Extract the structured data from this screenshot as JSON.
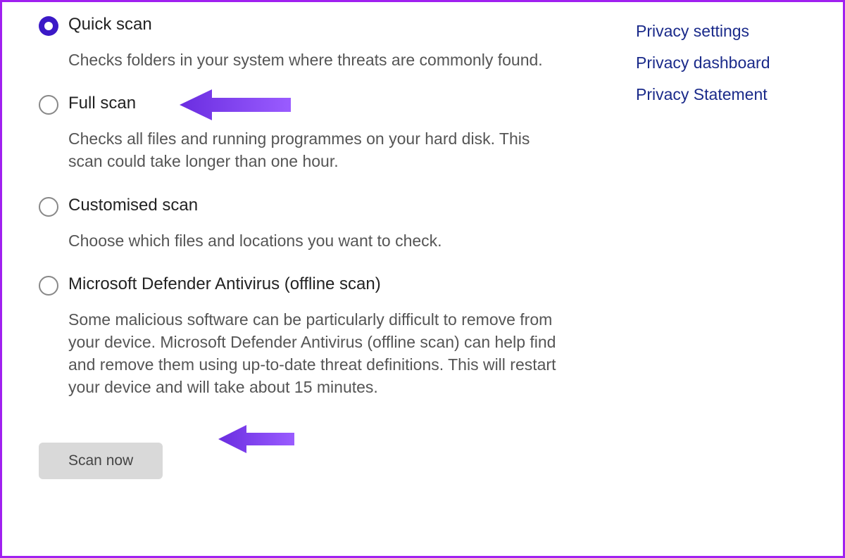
{
  "scanOptions": [
    {
      "title": "Quick scan",
      "description": "Checks folders in your system where threats are commonly found.",
      "selected": true
    },
    {
      "title": "Full scan",
      "description": "Checks all files and running programmes on your hard disk. This scan could take longer than one hour.",
      "selected": false
    },
    {
      "title": "Customised scan",
      "description": "Choose which files and locations you want to check.",
      "selected": false
    },
    {
      "title": "Microsoft Defender Antivirus (offline scan)",
      "description": "Some malicious software can be particularly difficult to remove from your device. Microsoft Defender Antivirus (offline scan) can help find and remove them using up-to-date threat definitions. This will restart your device and will take about 15 minutes.",
      "selected": false
    }
  ],
  "scanButton": {
    "label": "Scan now"
  },
  "sideLinks": [
    {
      "label": "Privacy settings"
    },
    {
      "label": "Privacy dashboard"
    },
    {
      "label": "Privacy Statement"
    }
  ],
  "colors": {
    "accent": "#3b19c7",
    "arrow": "#7b3ff2",
    "border": "#a020f0"
  }
}
